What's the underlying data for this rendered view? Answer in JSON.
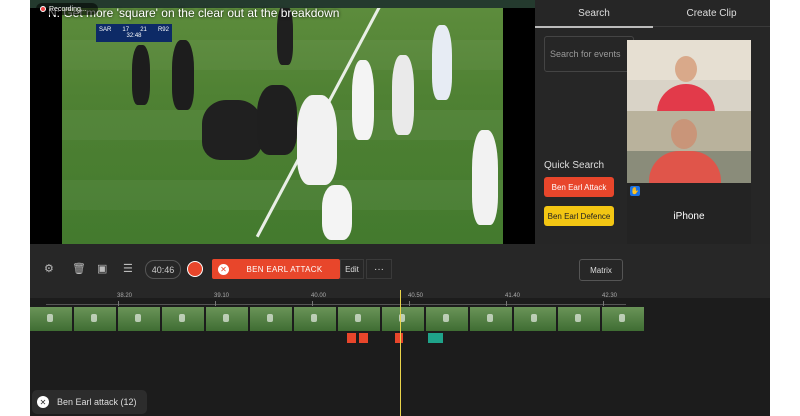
{
  "recording": {
    "label": "Recording..."
  },
  "video": {
    "caption": "N: Get more 'square' on the clear out at the breakdown",
    "scorebug": {
      "team_a": "SAR",
      "score_a_1": "17",
      "score_a_2": "21",
      "team_b": "R92",
      "clock": "32:48"
    }
  },
  "panel": {
    "tabs": [
      {
        "label": "Search"
      },
      {
        "label": "Create Clip"
      }
    ],
    "search_placeholder": "Search for events",
    "quick_search_label": "Quick Search",
    "quick_buttons": [
      {
        "label": "Ben Earl Attack",
        "color": "#e8462b"
      },
      {
        "label": "Ben Earl Defence",
        "color": "#f3c613"
      }
    ]
  },
  "call": {
    "iphone_label": "iPhone"
  },
  "toolbar": {
    "time": "40:46",
    "active_tag": "BEN EARL ATTACK",
    "edit_label": "Edit",
    "more_label": "···",
    "matrix_label": "Matrix",
    "icons": [
      "gear-icon",
      "trash-icon",
      "save-icon",
      "playlist-icon"
    ]
  },
  "timeline": {
    "ticks": [
      "38.20",
      "39.10",
      "40.00",
      "40.50",
      "41.40",
      "42.30"
    ]
  },
  "toast": {
    "label": "Ben Earl attack (12)"
  }
}
